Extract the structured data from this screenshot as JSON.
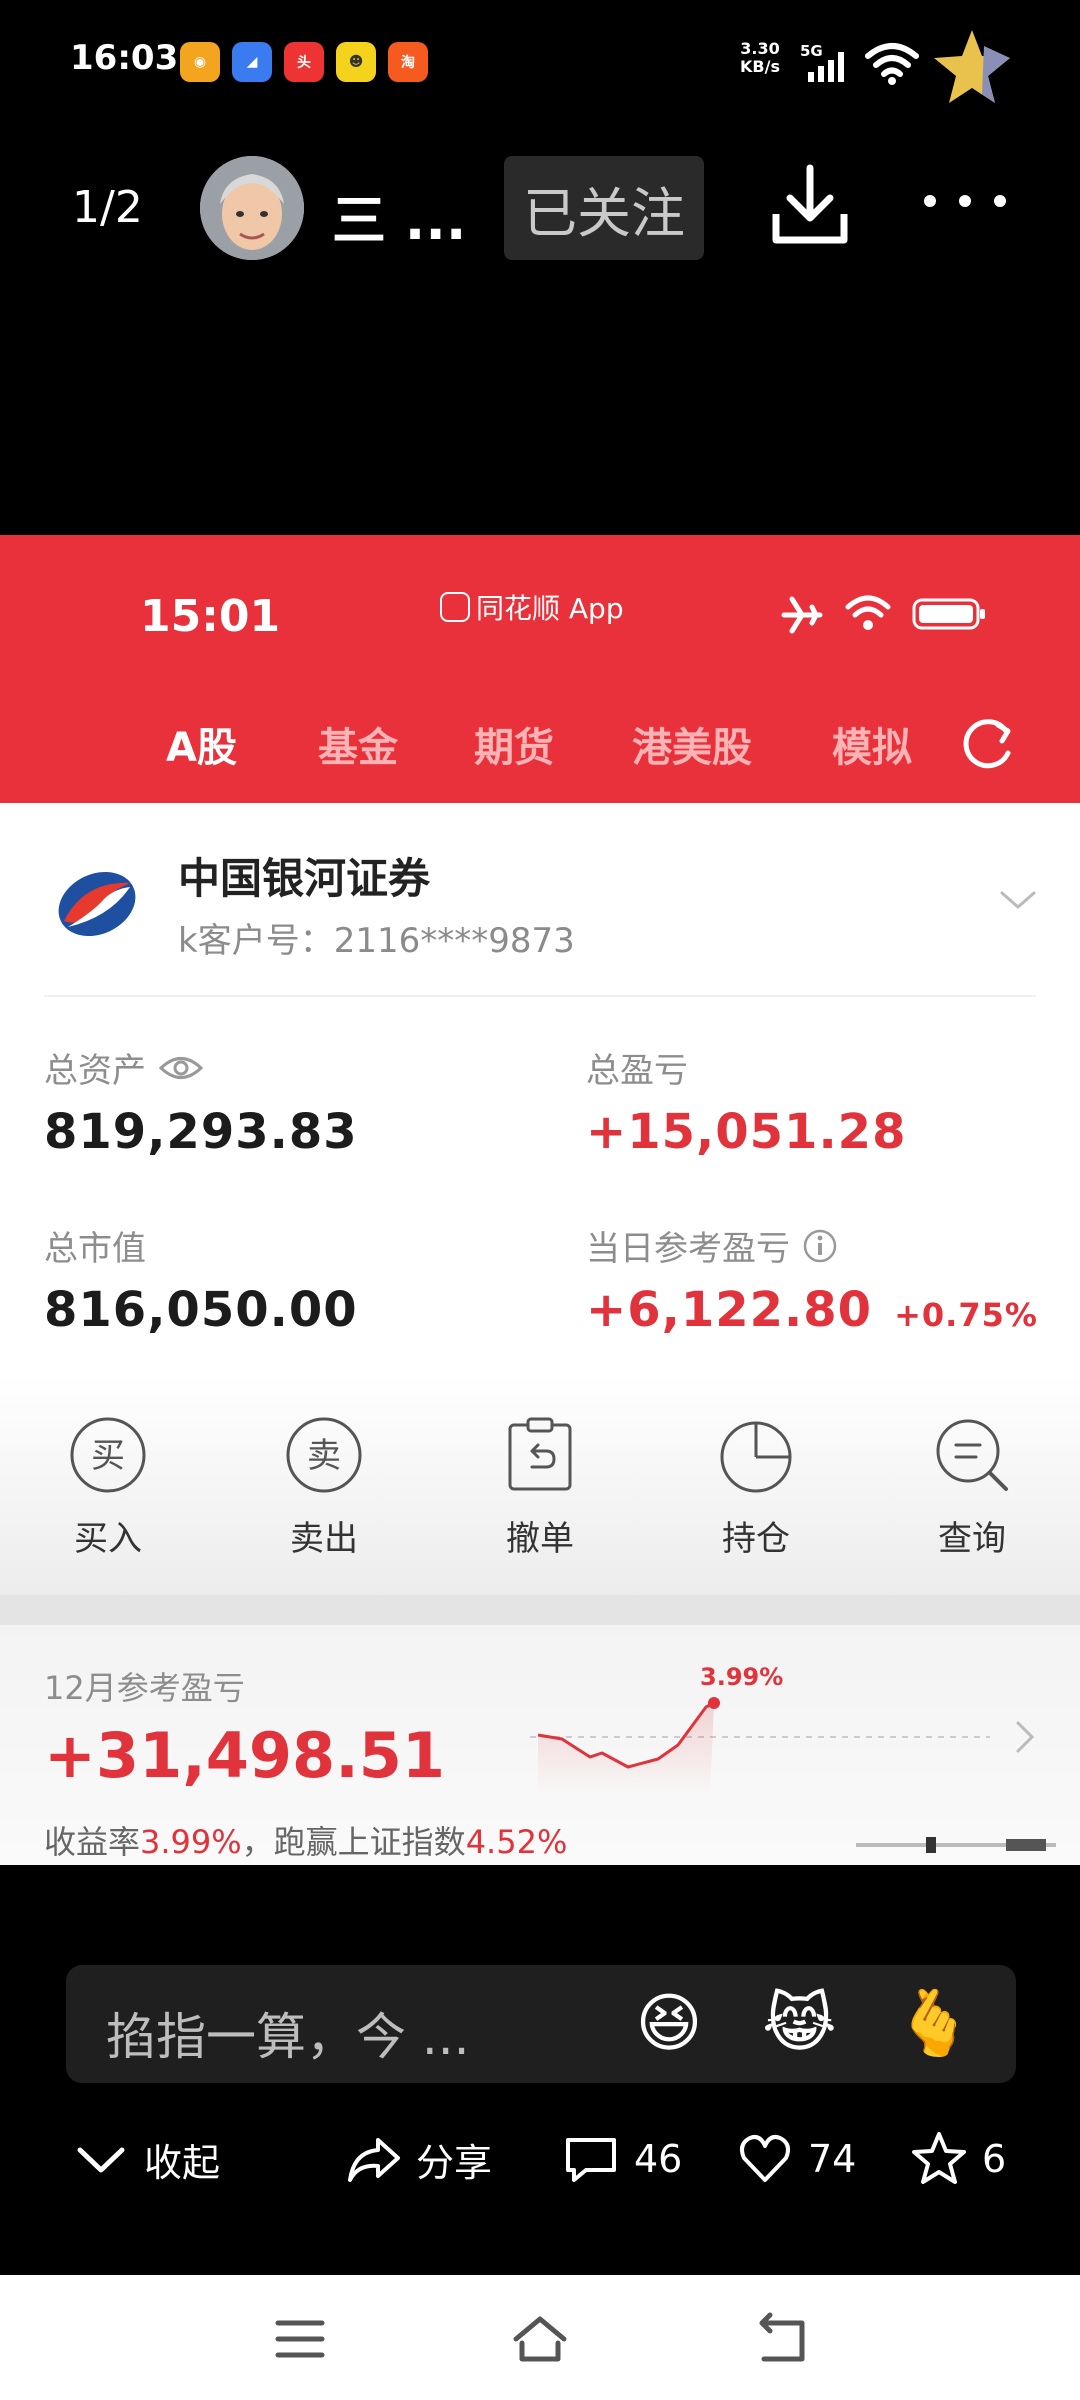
{
  "status_bar": {
    "time": "16:03",
    "net_speed_value": "3.30",
    "net_speed_unit": "KB/s",
    "network": "5G",
    "app_icons": [
      "weibo-icon",
      "app-blue-icon",
      "toutiao-icon",
      "app-yellow-icon",
      "taobao-icon"
    ]
  },
  "header": {
    "pager": "1/2",
    "username": "三 ...",
    "follow_label": "已关注"
  },
  "inner": {
    "status": {
      "time": "15:01",
      "app_name": "同花顺 App"
    },
    "tabs": [
      {
        "label": "A股",
        "active": true
      },
      {
        "label": "基金",
        "active": false
      },
      {
        "label": "期货",
        "active": false
      },
      {
        "label": "港美股",
        "active": false
      },
      {
        "label": "模拟",
        "active": false
      }
    ],
    "broker": {
      "name": "中国银河证券",
      "account": "k客户号：2116****9873"
    },
    "stats": {
      "total_assets_label": "总资产",
      "total_assets": "819,293.83",
      "total_pnl_label": "总盈亏",
      "total_pnl": "+15,051.28",
      "market_value_label": "总市值",
      "market_value": "816,050.00",
      "daily_pnl_label": "当日参考盈亏",
      "daily_pnl": "+6,122.80",
      "daily_pct": "+0.75%"
    },
    "actions": [
      {
        "label": "买入",
        "icon": "buy-icon",
        "glyph": "买"
      },
      {
        "label": "卖出",
        "icon": "sell-icon",
        "glyph": "卖"
      },
      {
        "label": "撤单",
        "icon": "cancel-order-icon"
      },
      {
        "label": "持仓",
        "icon": "position-icon"
      },
      {
        "label": "查询",
        "icon": "query-icon"
      }
    ],
    "monthly": {
      "label": "12月参考盈亏",
      "value": "+31,498.51",
      "rate_label": "收益率",
      "rate": "3.99%",
      "beat_label": "，跑赢上证指数",
      "beat": "4.52%",
      "spark_label": "3.99%"
    }
  },
  "comment": {
    "placeholder": "掐指一算，今 ...",
    "emojis": [
      "😆",
      "😹",
      "🫰"
    ]
  },
  "bottom_actions": {
    "collapse": "收起",
    "share": "分享",
    "comments": "46",
    "likes": "74",
    "favorites": "6"
  },
  "colors": {
    "brand_red": "#e8313a",
    "gain_red": "#e0333b"
  }
}
